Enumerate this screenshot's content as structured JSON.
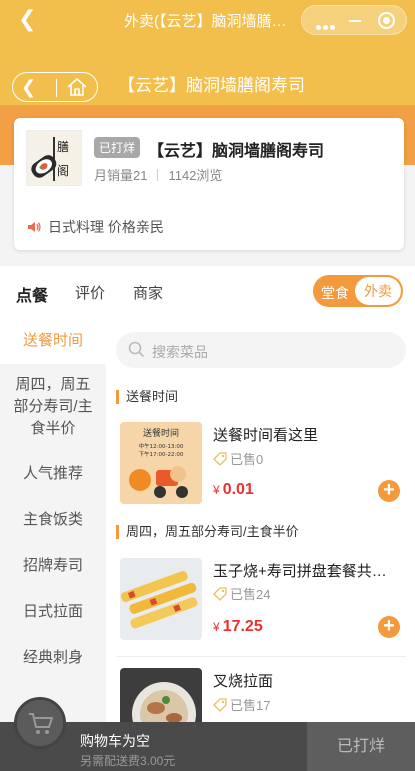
{
  "window": {
    "title": "外卖(【云艺】脑洞墙膳阁寿司",
    "back_icon": "chevron-left-icon"
  },
  "header": {
    "store_title": "【云艺】脑洞墙膳阁寿司"
  },
  "store": {
    "status_badge": "已打烊",
    "name": "【云艺】脑洞墙膳阁寿司",
    "monthly_sales": "月销量21",
    "views": "1142浏览",
    "notice": "日式料理 价格亲民",
    "logo_text": "膳阁"
  },
  "tabs": [
    {
      "label": "点餐",
      "active": true
    },
    {
      "label": "评价",
      "active": false
    },
    {
      "label": "商家",
      "active": false
    }
  ],
  "order_mode": {
    "dine_in": "堂食",
    "takeout": "外卖",
    "selected": "外卖"
  },
  "categories": [
    {
      "label": "送餐时间",
      "active": true
    },
    {
      "label": "周四，周五部分寿司/主食半价",
      "active": false
    },
    {
      "label": "人气推荐",
      "active": false
    },
    {
      "label": "主食饭类",
      "active": false
    },
    {
      "label": "招牌寿司",
      "active": false
    },
    {
      "label": "日式拉面",
      "active": false
    },
    {
      "label": "经典刺身",
      "active": false
    }
  ],
  "search": {
    "placeholder": "搜索菜品"
  },
  "sections": [
    {
      "title": "送餐时间",
      "items": [
        {
          "name": "送餐时间看这里",
          "sold": "已售0",
          "price": "0.01",
          "currency": "¥",
          "image_text": {
            "heading": "送餐时间",
            "line1": "中午12:00-13:00",
            "line2": "下午17:00-22:00"
          }
        }
      ]
    },
    {
      "title": "周四，周五部分寿司/主食半价",
      "items": [
        {
          "name": "玉子烧+寿司拼盘套餐共…",
          "sold": "已售24",
          "price": "17.25",
          "currency": "¥"
        },
        {
          "name": "叉烧拉面",
          "sold": "已售17",
          "price": "",
          "currency": "¥"
        }
      ]
    }
  ],
  "cart": {
    "empty_text": "购物车为空",
    "delivery_fee": "另需配送费3.00元",
    "checkout_label": "已打烊"
  },
  "colors": {
    "brand_yellow": "#f2bf4d",
    "brand_orange": "#f39a3c",
    "price_red": "#e8322f"
  }
}
